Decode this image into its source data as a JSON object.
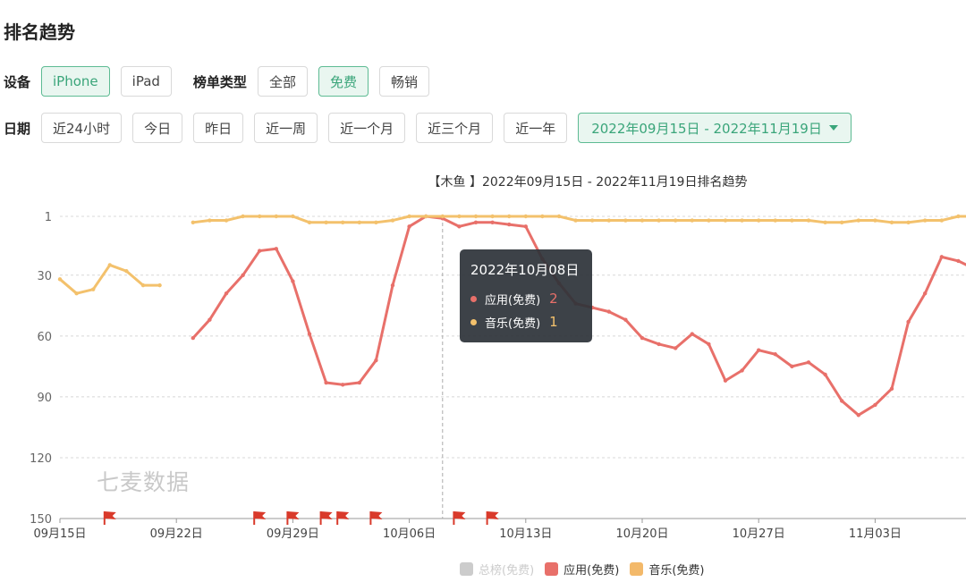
{
  "page": {
    "title": "排名趋势"
  },
  "filters": {
    "device_label": "设备",
    "devices": [
      "iPhone",
      "iPad"
    ],
    "device_active": 0,
    "list_type_label": "榜单类型",
    "list_types": [
      "全部",
      "免费",
      "畅销"
    ],
    "list_type_active": 1,
    "date_label": "日期",
    "date_ranges": [
      "近24小时",
      "今日",
      "昨日",
      "近一周",
      "近一个月",
      "近三个月",
      "近一年"
    ],
    "date_picker": "2022年09月15日 - 2022年11月19日"
  },
  "watermark": "七麦数据",
  "tooltip": {
    "title": "2022年10月08日",
    "rows": [
      {
        "label": "应用(免费)",
        "value": "2",
        "color": "#e8706a"
      },
      {
        "label": "音乐(免费)",
        "value": "1",
        "color": "#f3c16c"
      }
    ]
  },
  "chart_data": {
    "type": "line",
    "title": "【木鱼 】2022年09月15日 - 2022年11月19日排名趋势",
    "x_ticks": [
      "09月15日",
      "09月22日",
      "09月29日",
      "10月06日",
      "10月13日",
      "10月20日",
      "10月27日",
      "11月03日"
    ],
    "y_ticks": [
      1,
      30,
      60,
      90,
      120,
      150
    ],
    "ylim": [
      150,
      1
    ],
    "y_inverted": true,
    "series": [
      {
        "name": "总榜(免费)",
        "color": "#cccccc",
        "legend_disabled": true,
        "points": []
      },
      {
        "name": "应用(免费)",
        "color": "#e8706a",
        "points": [
          [
            "09-23",
            61
          ],
          [
            "09-24",
            52
          ],
          [
            "09-25",
            39
          ],
          [
            "09-26",
            30
          ],
          [
            "09-27",
            18
          ],
          [
            "09-28",
            17
          ],
          [
            "09-29",
            33
          ],
          [
            "09-30",
            59
          ],
          [
            "10-01",
            83
          ],
          [
            "10-02",
            84
          ],
          [
            "10-03",
            83
          ],
          [
            "10-04",
            72
          ],
          [
            "10-05",
            35
          ],
          [
            "10-06",
            6
          ],
          [
            "10-07",
            1
          ],
          [
            "10-08",
            2
          ],
          [
            "10-09",
            6
          ],
          [
            "10-10",
            4
          ],
          [
            "10-11",
            4
          ],
          [
            "10-12",
            5
          ],
          [
            "10-13",
            6
          ],
          [
            "10-14",
            22
          ],
          [
            "10-15",
            34
          ],
          [
            "10-16",
            44
          ],
          [
            "10-17",
            46
          ],
          [
            "10-18",
            48
          ],
          [
            "10-19",
            52
          ],
          [
            "10-20",
            61
          ],
          [
            "10-21",
            64
          ],
          [
            "10-22",
            66
          ],
          [
            "10-23",
            59
          ],
          [
            "10-24",
            64
          ],
          [
            "10-25",
            82
          ],
          [
            "10-26",
            77
          ],
          [
            "10-27",
            67
          ],
          [
            "10-28",
            69
          ],
          [
            "10-29",
            75
          ],
          [
            "10-30",
            73
          ],
          [
            "10-31",
            79
          ],
          [
            "11-01",
            92
          ],
          [
            "11-02",
            99
          ],
          [
            "11-03",
            94
          ],
          [
            "11-04",
            86
          ],
          [
            "11-05",
            53
          ],
          [
            "11-06",
            39
          ],
          [
            "11-07",
            21
          ],
          [
            "11-08",
            23
          ],
          [
            "11-09",
            27
          ]
        ]
      },
      {
        "name": "音乐(免费)",
        "color": "#f3c16c",
        "points": [
          [
            "09-15",
            32
          ],
          [
            "09-16",
            39
          ],
          [
            "09-17",
            37
          ],
          [
            "09-18",
            25
          ],
          [
            "09-19",
            28
          ],
          [
            "09-20",
            35
          ],
          [
            "09-21",
            35
          ],
          [
            "09-22",
            null
          ],
          [
            "09-23",
            4
          ],
          [
            "09-24",
            3
          ],
          [
            "09-25",
            3
          ],
          [
            "09-26",
            1
          ],
          [
            "09-27",
            1
          ],
          [
            "09-28",
            1
          ],
          [
            "09-29",
            1
          ],
          [
            "09-30",
            4
          ],
          [
            "10-01",
            4
          ],
          [
            "10-02",
            4
          ],
          [
            "10-03",
            4
          ],
          [
            "10-04",
            4
          ],
          [
            "10-05",
            3
          ],
          [
            "10-06",
            1
          ],
          [
            "10-07",
            1
          ],
          [
            "10-08",
            1
          ],
          [
            "10-09",
            1
          ],
          [
            "10-10",
            1
          ],
          [
            "10-11",
            1
          ],
          [
            "10-12",
            1
          ],
          [
            "10-13",
            1
          ],
          [
            "10-14",
            1
          ],
          [
            "10-15",
            1
          ],
          [
            "10-16",
            3
          ],
          [
            "10-17",
            3
          ],
          [
            "10-18",
            3
          ],
          [
            "10-19",
            3
          ],
          [
            "10-20",
            3
          ],
          [
            "10-21",
            3
          ],
          [
            "10-22",
            3
          ],
          [
            "10-23",
            3
          ],
          [
            "10-24",
            3
          ],
          [
            "10-25",
            3
          ],
          [
            "10-26",
            3
          ],
          [
            "10-27",
            3
          ],
          [
            "10-28",
            3
          ],
          [
            "10-29",
            3
          ],
          [
            "10-30",
            3
          ],
          [
            "10-31",
            4
          ],
          [
            "11-01",
            4
          ],
          [
            "11-02",
            3
          ],
          [
            "11-03",
            3
          ],
          [
            "11-04",
            4
          ],
          [
            "11-05",
            4
          ],
          [
            "11-06",
            3
          ],
          [
            "11-07",
            3
          ],
          [
            "11-08",
            1
          ],
          [
            "11-09",
            1
          ]
        ]
      }
    ],
    "markers": [
      "09-18",
      "09-27",
      "09-29",
      "10-01",
      "10-02",
      "10-04",
      "10-09",
      "10-11"
    ],
    "marker_color": "#d93a2b",
    "hover_date": "10-08",
    "legend_position": "bottom"
  }
}
